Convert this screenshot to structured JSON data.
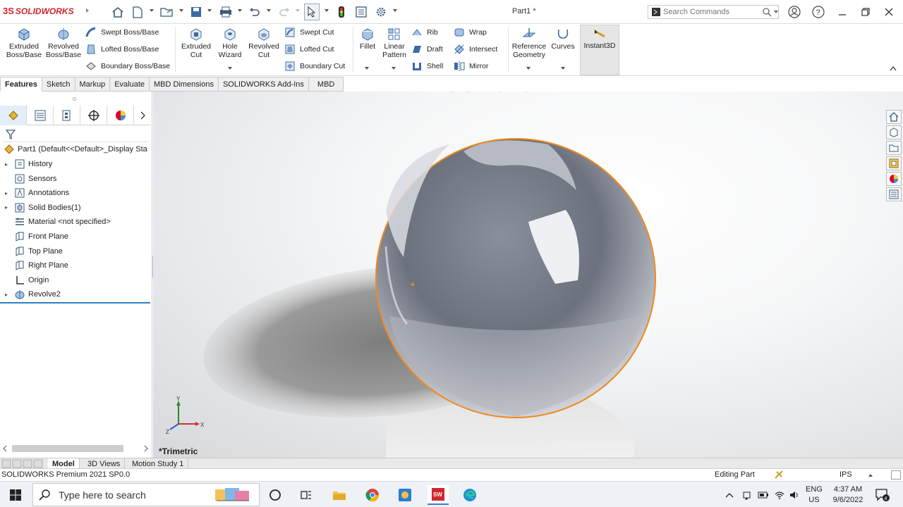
{
  "app": {
    "brand": "SOLIDWORKS",
    "brand_prefix": "3S",
    "document_title": "Part1 *"
  },
  "search": {
    "placeholder": "Search Commands"
  },
  "ribbon": {
    "features_col1": [
      {
        "label": "Extruded\nBoss/Base",
        "icon": "extruded-boss-icon"
      },
      {
        "label": "Revolved\nBoss/Base",
        "icon": "revolved-boss-icon"
      }
    ],
    "features_col2": [
      "Swept Boss/Base",
      "Lofted Boss/Base",
      "Boundary Boss/Base"
    ],
    "cut_col1": [
      {
        "label": "Extruded\nCut"
      },
      {
        "label": "Hole\nWizard"
      },
      {
        "label": "Revolved\nCut"
      }
    ],
    "cut_col2": [
      "Swept Cut",
      "Lofted Cut",
      "Boundary Cut"
    ],
    "fillet": "Fillet",
    "linear_pattern": "Linear\nPattern",
    "col_rib": [
      "Rib",
      "Draft",
      "Shell"
    ],
    "col_wrap": [
      "Wrap",
      "Intersect",
      "Mirror"
    ],
    "reference_geometry": "Reference\nGeometry",
    "curves": "Curves",
    "instant3d": "Instant3D"
  },
  "command_tabs": [
    "Features",
    "Sketch",
    "Markup",
    "Evaluate",
    "MBD Dimensions",
    "SOLIDWORKS Add-Ins",
    "MBD"
  ],
  "tree": {
    "root": "Part1  (Default<<Default>_Display Sta",
    "items": [
      {
        "label": "History",
        "expandable": true,
        "icon": "history-icon"
      },
      {
        "label": "Sensors",
        "expandable": false,
        "icon": "sensors-icon"
      },
      {
        "label": "Annotations",
        "expandable": true,
        "icon": "annotations-icon"
      },
      {
        "label": "Solid Bodies(1)",
        "expandable": true,
        "icon": "solid-bodies-icon"
      },
      {
        "label": "Material <not specified>",
        "expandable": false,
        "icon": "material-icon"
      },
      {
        "label": "Front Plane",
        "expandable": false,
        "icon": "plane-icon"
      },
      {
        "label": "Top Plane",
        "expandable": false,
        "icon": "plane-icon"
      },
      {
        "label": "Right Plane",
        "expandable": false,
        "icon": "plane-icon"
      },
      {
        "label": "Origin",
        "expandable": false,
        "icon": "origin-icon"
      },
      {
        "label": "Revolve2",
        "expandable": true,
        "icon": "revolve-feature-icon"
      }
    ]
  },
  "viewport": {
    "view_name": "*Trimetric",
    "axis_labels": {
      "x": "X",
      "y": "Y",
      "z": "Z"
    },
    "selection_color": "#f08a1c"
  },
  "bottom_tabs": [
    "Model",
    "3D Views",
    "Motion Study 1"
  ],
  "status": {
    "product": "SOLIDWORKS Premium 2021 SP0.0",
    "mode": "Editing Part",
    "units": "IPS"
  },
  "taskbar": {
    "search_placeholder": "Type here to search",
    "lang": "ENG",
    "region": "US",
    "time": "4:37 AM",
    "date": "9/6/2022",
    "notification_count": "4"
  }
}
